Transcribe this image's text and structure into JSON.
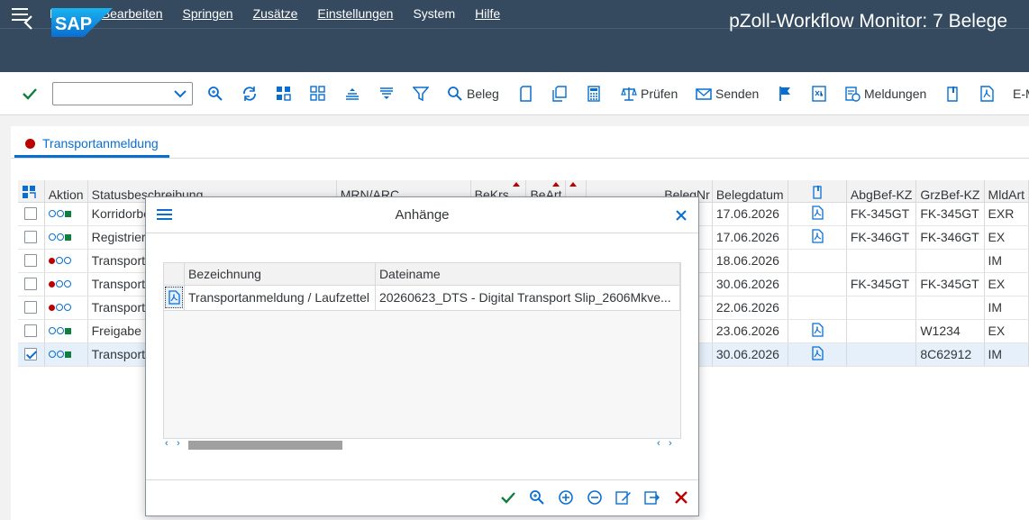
{
  "menubar": {
    "items": [
      {
        "label": "Beleg"
      },
      {
        "label": "Bearbeiten"
      },
      {
        "label": "Springen"
      },
      {
        "label": "Zusätze"
      },
      {
        "label": "Einstellungen"
      },
      {
        "label": "System"
      },
      {
        "label": "Hilfe"
      }
    ]
  },
  "titlebar": {
    "logo_text": "SAP",
    "title": "pZoll-Workflow Monitor: 7 Belege"
  },
  "toolbar": {
    "command_field_value": "",
    "beleg_label": "Beleg",
    "pruefen_label": "Prüfen",
    "senden_label": "Senden",
    "meldungen_label": "Meldungen",
    "email_label": "E-M"
  },
  "tab": {
    "label": "Transportanmeldung"
  },
  "grid": {
    "columns": [
      "Aktion",
      "Statusbeschreibung",
      "MRN/ARC",
      "BeKrs",
      "BeArt",
      "",
      "BelegNr",
      "Belegdatum",
      "",
      "AbgBef-KZ",
      "GrzBef-KZ",
      "MldArt"
    ],
    "rows": [
      {
        "selected": false,
        "lights": "ocg",
        "status": "Korridorbe",
        "date": "17.06.2026",
        "doc_icon": true,
        "abg": "FK-345GT",
        "grz": "FK-345GT",
        "mld": "EXR"
      },
      {
        "selected": false,
        "lights": "ocg",
        "status": "Registrier",
        "date": "17.06.2026",
        "doc_icon": true,
        "abg": "FK-346GT",
        "grz": "FK-346GT",
        "mld": "EX"
      },
      {
        "selected": false,
        "lights": "roo",
        "status": "Transport",
        "date": "18.06.2026",
        "doc_icon": false,
        "abg": "",
        "grz": "",
        "mld": "IM"
      },
      {
        "selected": false,
        "lights": "roo",
        "status": "Transport",
        "date": "30.06.2026",
        "doc_icon": false,
        "abg": "FK-345GT",
        "grz": "FK-345GT",
        "mld": "EX"
      },
      {
        "selected": false,
        "lights": "roo",
        "status": "Transport",
        "date": "22.06.2026",
        "doc_icon": false,
        "abg": "",
        "grz": "",
        "mld": "IM"
      },
      {
        "selected": false,
        "lights": "ocg",
        "status": "Freigabe",
        "date": "23.06.2026",
        "doc_icon": true,
        "abg": "",
        "grz": "W1234",
        "mld": "EX"
      },
      {
        "selected": true,
        "lights": "ocg",
        "status": "Transport",
        "date": "30.06.2026",
        "doc_icon": true,
        "abg": "",
        "grz": "8C62912",
        "mld": "IM"
      }
    ]
  },
  "dialog": {
    "title": "Anhänge",
    "columns": [
      "Bezeichnung",
      "Dateiname"
    ],
    "rows": [
      {
        "bezeichnung": "Transportanmeldung / Laufzettel",
        "dateiname": "20260623_DTS - Digital Transport Slip_2606Mkve..."
      }
    ]
  },
  "colors": {
    "shell": "#354a5f",
    "accent": "#0a6ed1",
    "error": "#bb0000",
    "success": "#107e3e"
  }
}
